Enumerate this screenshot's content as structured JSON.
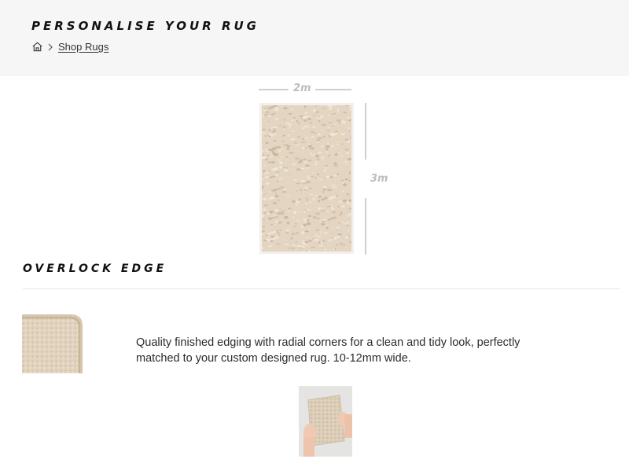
{
  "header": {
    "title": "PERSONALISE YOUR RUG",
    "breadcrumb": {
      "home_icon": "home-icon",
      "separator_icon": "chevron-right-icon",
      "link_label": "Shop Rugs"
    }
  },
  "preview": {
    "width_label": "2m",
    "height_label": "3m",
    "rug_colors": {
      "base": "#e3d5c2",
      "speckle_dark": "#c8b59c",
      "speckle_light": "#f2e9dc"
    }
  },
  "overlock": {
    "title": "OVERLOCK EDGE",
    "description": "Quality finished edging with radial corners for a clean and tidy look, perfectly matched to your custom designed rug. 10-12mm wide."
  }
}
